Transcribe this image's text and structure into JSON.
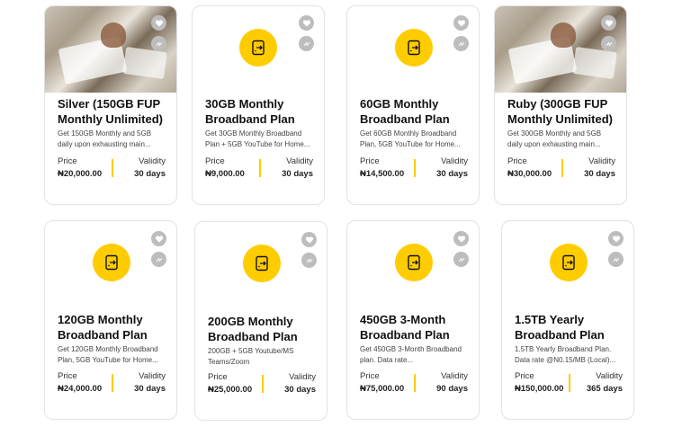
{
  "plans": [
    {
      "title": "Silver (150GB FUP Monthly Unlimited)",
      "desc": "Get 150GB Monthly and 5GB daily upon exhausting main...",
      "price_label": "Price",
      "price": "₦20,000.00",
      "validity_label": "Validity",
      "validity": "30 days",
      "media": "photo"
    },
    {
      "title": "30GB Monthly Broadband Plan",
      "desc": "Get 30GB Monthly Broadband Plan + 5GB YouTube for Home...",
      "price_label": "Price",
      "price": "₦9,000.00",
      "validity_label": "Validity",
      "validity": "30 days",
      "media": "router-icon"
    },
    {
      "title": "60GB Monthly Broadband Plan",
      "desc": "Get 60GB Monthly Broadband Plan, 5GB YouTube for Home...",
      "price_label": "Price",
      "price": "₦14,500.00",
      "validity_label": "Validity",
      "validity": "30 days",
      "media": "router-icon"
    },
    {
      "title": "Ruby (300GB FUP Monthly Unlimited)",
      "desc": "Get 300GB Monthly and 5GB daily upon exhausting main...",
      "price_label": "Price",
      "price": "₦30,000.00",
      "validity_label": "Validity",
      "validity": "30 days",
      "media": "photo"
    },
    {
      "title": "120GB Monthly Broadband Plan",
      "desc": "Get 120GB Monthly Broadband Plan, 5GB YouTube for Home...",
      "price_label": "Price",
      "price": "₦24,000.00",
      "validity_label": "Validity",
      "validity": "30 days",
      "media": "router-icon"
    },
    {
      "title": "200GB Monthly Broadband Plan",
      "desc": "200GB + 5GB Youtube/MS Teams/Zoom",
      "price_label": "Price",
      "price": "₦25,000.00",
      "validity_label": "Validity",
      "validity": "30 days",
      "media": "router-icon"
    },
    {
      "title": "450GB 3-Month Broadband Plan",
      "desc": "Get 450GB 3-Month Broadband plan. Data rate...",
      "price_label": "Price",
      "price": "₦75,000.00",
      "validity_label": "Validity",
      "validity": "90 days",
      "media": "router-icon"
    },
    {
      "title": "1.5TB Yearly Broadband Plan",
      "desc": "1.5TB Yearly Broadband Plan. Data rate @N0.15/MB (Local)...",
      "price_label": "Price",
      "price": "₦150,000.00",
      "validity_label": "Validity",
      "validity": "365 days",
      "media": "router-icon"
    }
  ],
  "icons": {
    "favorite": "heart-icon",
    "compare": "compare-arrows-icon",
    "media": "router-wifi-icon"
  },
  "colors": {
    "accent": "#ffcc00",
    "icon_button": "#bdbdbd"
  }
}
